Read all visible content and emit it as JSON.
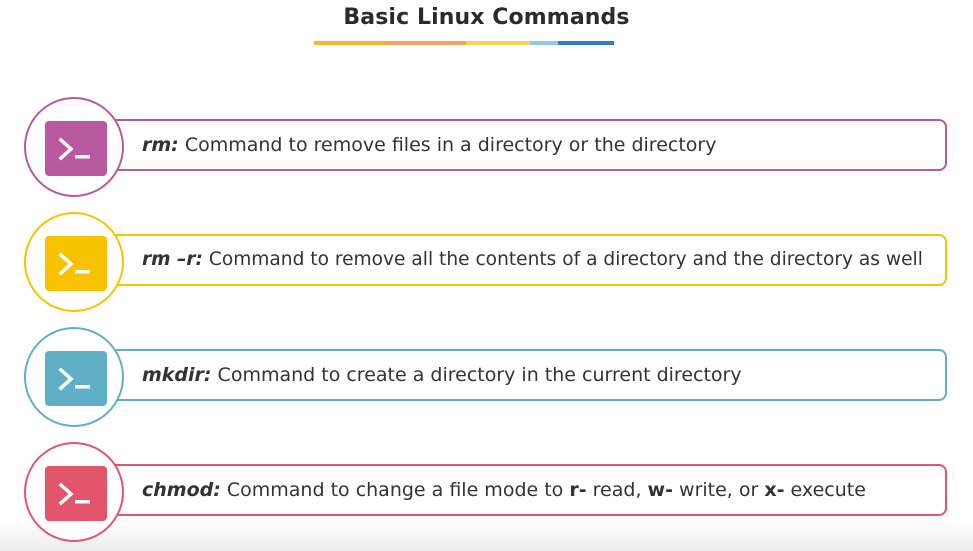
{
  "title": "Basic Linux Commands",
  "colors": {
    "underline": [
      "#f7b52c",
      "#f4a261",
      "#f6d45a",
      "#8ecae6",
      "#2f7fbf"
    ],
    "items": [
      "#b8589f",
      "#f7c300",
      "#5fb0c7",
      "#e2556a"
    ]
  },
  "items": [
    {
      "command": "rm:",
      "description": " Command to remove files in a directory or the directory",
      "icon": "terminal-icon"
    },
    {
      "command": "rm –r:",
      "description": " Command to remove all the contents of a directory and the directory as well",
      "icon": "terminal-icon"
    },
    {
      "command": "mkdir:",
      "description": " Command to create a directory in the current directory",
      "icon": "terminal-icon"
    },
    {
      "command": "chmod:",
      "description_parts": [
        " Command to change a file mode to ",
        "r-",
        " read, ",
        "w-",
        " write, or ",
        "x-",
        " execute"
      ],
      "icon": "terminal-icon"
    }
  ]
}
